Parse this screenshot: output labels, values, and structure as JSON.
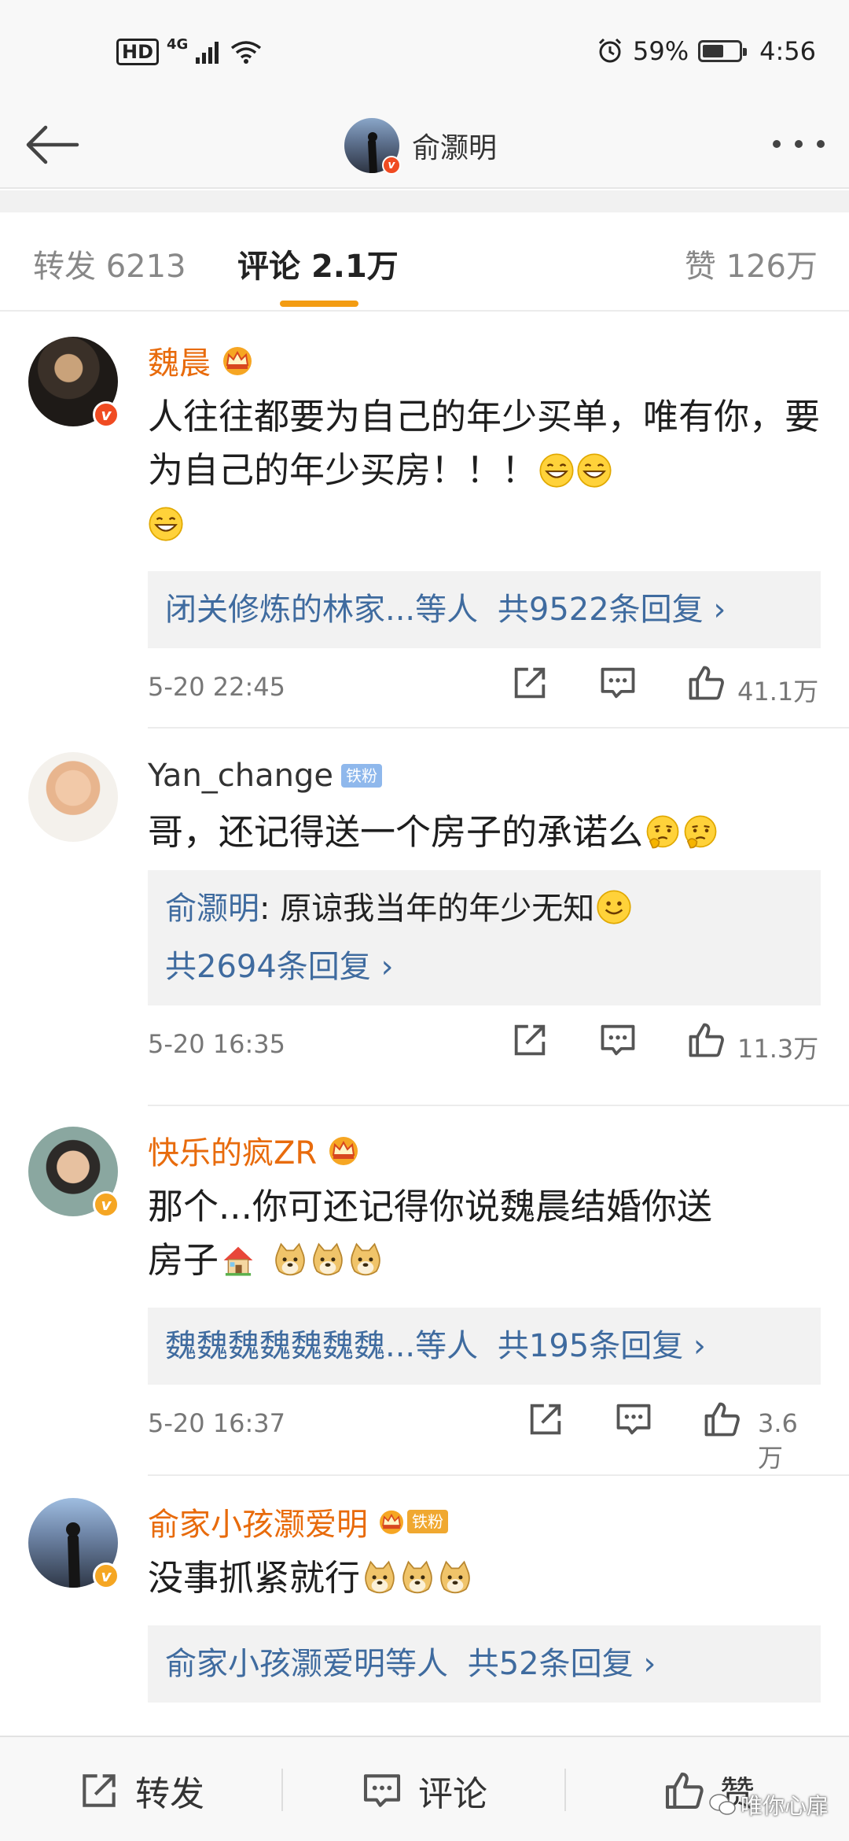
{
  "status_bar": {
    "hd": "HD",
    "network": "4G",
    "battery_percent": "59%",
    "battery_level": 0.59,
    "time": "4:56"
  },
  "nav": {
    "title": "俞灏明"
  },
  "tabs": [
    {
      "label": "转发",
      "count": "6213"
    },
    {
      "label": "评论",
      "count": "2.1万"
    },
    {
      "label": "赞",
      "count": "126万"
    }
  ],
  "comments": [
    {
      "name": "魏晨",
      "text": "人往往都要为自己的年少买单，唯有你，要为自己的年少买房！！！",
      "emojis": [
        "grin-emoji",
        "grin-emoji",
        "grin-emoji"
      ],
      "reply": {
        "users": "闭关修炼的林家...等人",
        "count": "共9522条回复 ›"
      },
      "time": "5-20 22:45",
      "likes": "41.1万"
    },
    {
      "name": "Yan_change",
      "tag": "铁粉",
      "text": "哥，还记得送一个房子的承诺么",
      "emojis": [
        "thinking-emoji",
        "thinking-emoji"
      ],
      "reply": {
        "author": "俞灏明",
        "text": ": 原谅我当年的年少无知",
        "count": "共2694条回复 ›"
      },
      "time": "5-20 16:35",
      "likes": "11.3万"
    },
    {
      "name": "快乐的疯ZR",
      "text_line1": "那个...你可还记得你说魏晨结婚你送",
      "text_line2": "房子",
      "emojis": [
        "house-emoji",
        "doge-emoji",
        "doge-emoji",
        "doge-emoji"
      ],
      "reply": {
        "users": "魏魏魏魏魏魏魏...等人",
        "count": "共195条回复 ›"
      },
      "time": "5-20 16:37",
      "likes": "3.6万"
    },
    {
      "name": "俞家小孩灏爱明",
      "tag": "铁粉",
      "text": "没事抓紧就行",
      "emojis": [
        "doge-emoji",
        "doge-emoji",
        "doge-emoji"
      ],
      "reply": {
        "users": "俞家小孩灏爱明等人",
        "count": "共52条回复 ›"
      }
    }
  ],
  "bottom_bar": {
    "repost": "转发",
    "comment": "评论",
    "like": "赞"
  },
  "watermark": "唯你心扉",
  "colors": {
    "accent": "#f39c12",
    "username": "#e86b0c",
    "link": "#3f6b9f",
    "verified_red": "#f04b22",
    "verified_yellow": "#f5a623"
  }
}
